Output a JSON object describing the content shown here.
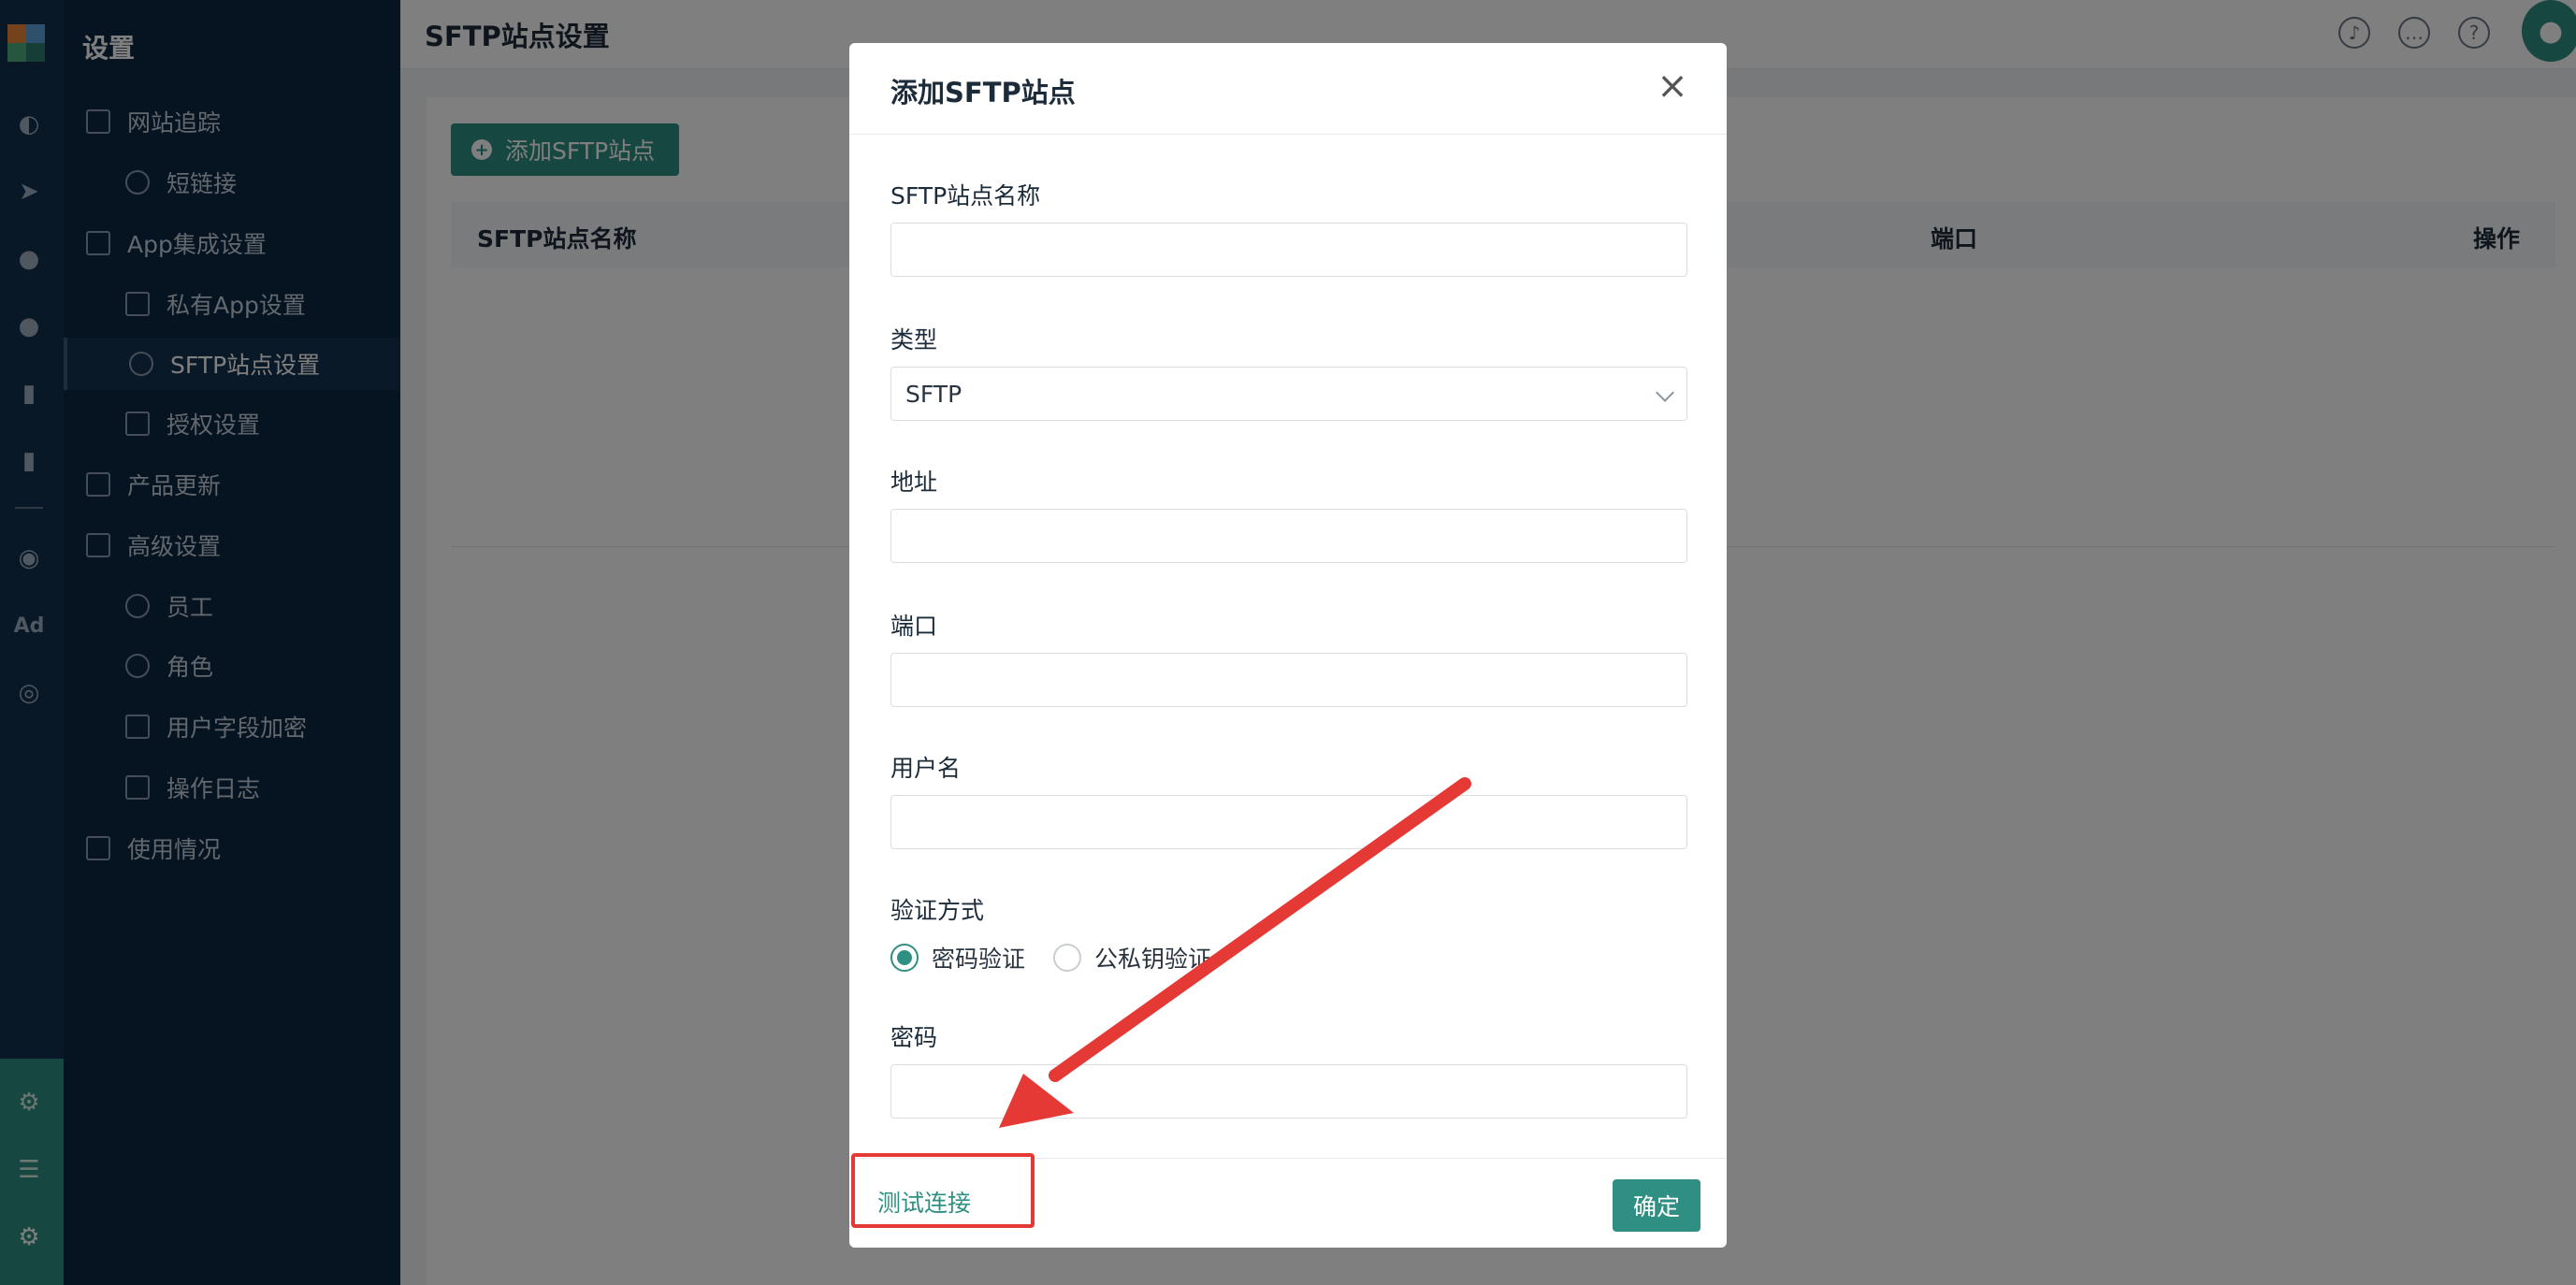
{
  "sidebar": {
    "title": "设置",
    "items": [
      {
        "label": "网站追踪",
        "icon": "folder-icon"
      },
      {
        "label": "短链接",
        "icon": "link-icon"
      },
      {
        "label": "App集成设置",
        "icon": "folder-icon"
      },
      {
        "label": "私有App设置",
        "icon": "apps-icon"
      },
      {
        "label": "SFTP站点设置",
        "icon": "globe-icon"
      },
      {
        "label": "授权设置",
        "icon": "shield-icon"
      },
      {
        "label": "产品更新",
        "icon": "grid-icon"
      },
      {
        "label": "高级设置",
        "icon": "folder-icon"
      },
      {
        "label": "员工",
        "icon": "user-icon"
      },
      {
        "label": "角色",
        "icon": "user-role-icon"
      },
      {
        "label": "用户字段加密",
        "icon": "encrypt-icon"
      },
      {
        "label": "操作日志",
        "icon": "log-icon"
      },
      {
        "label": "使用情况",
        "icon": "usage-icon"
      }
    ],
    "active_item": "SFTP站点设置"
  },
  "rail": {
    "ad_label": "Ad"
  },
  "header": {
    "title": "SFTP站点设置"
  },
  "main": {
    "add_button": "添加SFTP站点",
    "table_headers": [
      "SFTP站点名称",
      "端口",
      "操作"
    ]
  },
  "modal": {
    "title": "添加SFTP站点",
    "fields": {
      "name_label": "SFTP站点名称",
      "type_label": "类型",
      "type_value": "SFTP",
      "address_label": "地址",
      "port_label": "端口",
      "username_label": "用户名",
      "auth_label": "验证方式",
      "auth_option_password": "密码验证",
      "auth_option_key": "公私钥验证",
      "auth_selected": "密码验证",
      "password_label": "密码"
    },
    "test_connection": "测试连接",
    "confirm": "确定"
  },
  "colors": {
    "accent": "#2f8f82",
    "sidebar_bg": "#0d2640",
    "annotation_red": "#e53935"
  }
}
